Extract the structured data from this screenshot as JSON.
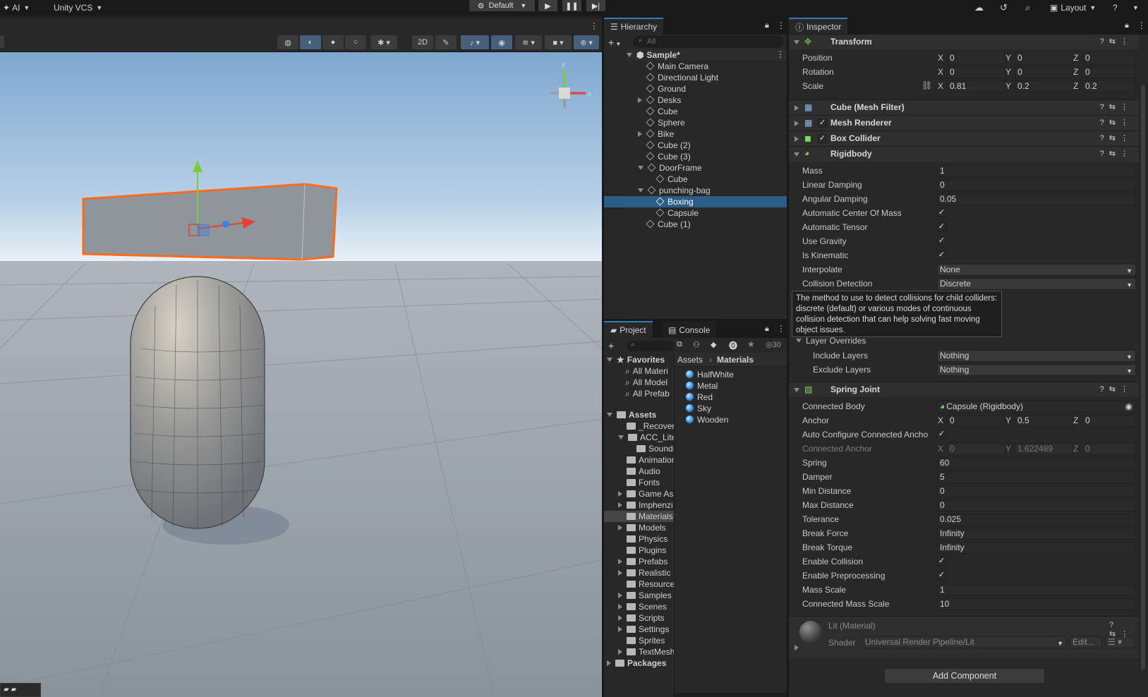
{
  "topbar": {
    "ai_label": "AI",
    "vcs_label": "Unity VCS",
    "layout_default": "Default",
    "layout_label": "Layout"
  },
  "hierarchy": {
    "tab": "Hierarchy",
    "search_placeholder": "All",
    "scene_name": "Sample*",
    "items": [
      {
        "label": "Main Camera"
      },
      {
        "label": "Directional Light"
      },
      {
        "label": "Ground"
      },
      {
        "label": "Desks"
      },
      {
        "label": "Cube"
      },
      {
        "label": "Sphere"
      },
      {
        "label": "Bike"
      },
      {
        "label": "Cube (2)"
      },
      {
        "label": "Cube (3)"
      },
      {
        "label": "DoorFrame"
      },
      {
        "label": "Cube"
      },
      {
        "label": "punching-bag"
      },
      {
        "label": "Boxing"
      },
      {
        "label": "Capsule"
      },
      {
        "label": "Cube (1)"
      }
    ]
  },
  "project": {
    "tab_project": "Project",
    "tab_console": "Console",
    "count_badge": "30",
    "favorites_label": "Favorites",
    "favorites": [
      "All Materi",
      "All Model",
      "All Prefab"
    ],
    "assets_label": "Assets",
    "folders": [
      "_Recover",
      "ACC_Lite",
      "Sounds",
      "Animation",
      "Audio",
      "Fonts",
      "Game As",
      "Imphenzi",
      "Materials",
      "Models",
      "Physics",
      "Plugins",
      "Prefabs",
      "Realistic",
      "Resource",
      "Samples",
      "Scenes",
      "Scripts",
      "Settings",
      "Sprites",
      "TextMesh"
    ],
    "packages_label": "Packages",
    "breadcrumb": [
      "Assets",
      "Materials"
    ],
    "materials": [
      "HalfWhite",
      "Metal",
      "Red",
      "Sky",
      "Wooden"
    ]
  },
  "inspector": {
    "tab": "Inspector",
    "transform": {
      "title": "Transform",
      "position_label": "Position",
      "position": {
        "x": "0",
        "y": "0",
        "z": "0"
      },
      "rotation_label": "Rotation",
      "rotation": {
        "x": "0",
        "y": "0",
        "z": "0"
      },
      "scale_label": "Scale",
      "scale": {
        "x": "0.81",
        "y": "0.2",
        "z": "0.2"
      }
    },
    "mesh_filter_title": "Cube (Mesh Filter)",
    "mesh_renderer_title": "Mesh Renderer",
    "box_collider_title": "Box Collider",
    "rigidbody": {
      "title": "Rigidbody",
      "mass_label": "Mass",
      "mass": "1",
      "linear_damping_label": "Linear Damping",
      "linear_damping": "0",
      "angular_damping_label": "Angular Damping",
      "angular_damping": "0.05",
      "auto_com_label": "Automatic Center Of Mass",
      "auto_tensor_label": "Automatic Tensor",
      "use_gravity_label": "Use Gravity",
      "is_kinematic_label": "Is Kinematic",
      "interpolate_label": "Interpolate",
      "interpolate": "None",
      "collision_label": "Collision Detection",
      "collision": "Discrete",
      "tooltip": "The method to use to detect collisions for child colliders: discrete (default) or various modes of continuous collision detection that can help solving fast moving object issues.",
      "layer_overrides_label": "Layer Overrides",
      "include_layers_label": "Include Layers",
      "include_layers": "Nothing",
      "exclude_layers_label": "Exclude Layers",
      "exclude_layers": "Nothing"
    },
    "spring_joint": {
      "title": "Spring Joint",
      "connected_body_label": "Connected Body",
      "connected_body": "Capsule (Rigidbody)",
      "anchor_label": "Anchor",
      "anchor": {
        "x": "0",
        "y": "0.5",
        "z": "0"
      },
      "auto_configure_label": "Auto Configure Connected Ancho",
      "connected_anchor_label": "Connected Anchor",
      "connected_anchor": {
        "x": "0",
        "y": "1.622489",
        "z": "0"
      },
      "spring_label": "Spring",
      "spring": "60",
      "damper_label": "Damper",
      "damper": "5",
      "min_distance_label": "Min Distance",
      "min_distance": "0",
      "max_distance_label": "Max Distance",
      "max_distance": "0",
      "tolerance_label": "Tolerance",
      "tolerance": "0.025",
      "break_force_label": "Break Force",
      "break_force": "Infinity",
      "break_torque_label": "Break Torque",
      "break_torque": "Infinity",
      "enable_collision_label": "Enable Collision",
      "enable_preprocessing_label": "Enable Preprocessing",
      "mass_scale_label": "Mass Scale",
      "mass_scale": "1",
      "connected_mass_scale_label": "Connected Mass Scale",
      "connected_mass_scale": "10"
    },
    "material": {
      "title": "Lit (Material)",
      "shader_label": "Shader",
      "shader": "Universal Render Pipeline/Lit",
      "edit_label": "Edit..."
    },
    "add_component": "Add Component"
  },
  "colors": {
    "selection": "#2c5d87",
    "accent_tab": "#3a79bb",
    "selected_outline": "#ff6a1a",
    "gizmo_x": "#e8402f",
    "gizmo_y": "#7ecb3a",
    "gizmo_z": "#3a82e6"
  }
}
